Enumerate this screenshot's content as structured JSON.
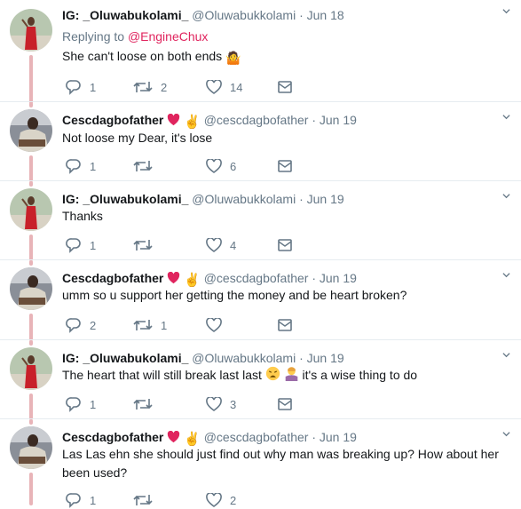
{
  "tweets": [
    {
      "name": "IG: _Oluwabukolami_",
      "handle": "@Oluwabukkolami",
      "date": "· Jun 18",
      "reply_prefix": "Replying to",
      "reply_mention": "@EngineChux",
      "text": "She can't loose on both ends",
      "emoji": "🤷",
      "counts": {
        "reply": "1",
        "retweet": "2",
        "like": "14"
      },
      "avatar": "red-dress"
    },
    {
      "name": "Cescdagbofather",
      "handle": "@cescdagbofather",
      "date": "· Jun 19",
      "text": "Not loose my Dear,  it's lose",
      "counts": {
        "reply": "1",
        "retweet": "",
        "like": "6"
      },
      "avatar": "man-seated"
    },
    {
      "name": "IG: _Oluwabukolami_",
      "handle": "@Oluwabukkolami",
      "date": "· Jun 19",
      "text": "Thanks",
      "counts": {
        "reply": "1",
        "retweet": "",
        "like": "4"
      },
      "avatar": "red-dress"
    },
    {
      "name": "Cescdagbofather",
      "handle": "@cescdagbofather",
      "date": "· Jun 19",
      "text": "umm so u support her getting the money and be heart broken?",
      "counts": {
        "reply": "2",
        "retweet": "1",
        "like": ""
      },
      "avatar": "man-seated"
    },
    {
      "name": "IG: _Oluwabukolami_",
      "handle": "@Oluwabukkolami",
      "date": "· Jun 19",
      "text_a": "The heart that will still break last last",
      "text_b": " it's a wise thing to do",
      "counts": {
        "reply": "1",
        "retweet": "",
        "like": "3"
      },
      "avatar": "red-dress"
    },
    {
      "name": "Cescdagbofather",
      "handle": "@cescdagbofather",
      "date": "· Jun 19",
      "text": "Las Las ehn she should just find out why man was breaking up?  How about her been used?",
      "counts": {
        "reply": "1",
        "retweet": "",
        "like": "2"
      },
      "avatar": "man-seated"
    }
  ],
  "icons": {
    "reply": "reply-icon",
    "retweet": "retweet-icon",
    "like": "heart-icon",
    "dm": "envelope-icon",
    "caret": "chevron-down-icon"
  },
  "colors": {
    "thread_line": "#e8b4b8",
    "mention": "#e0245e",
    "muted": "#657786"
  }
}
